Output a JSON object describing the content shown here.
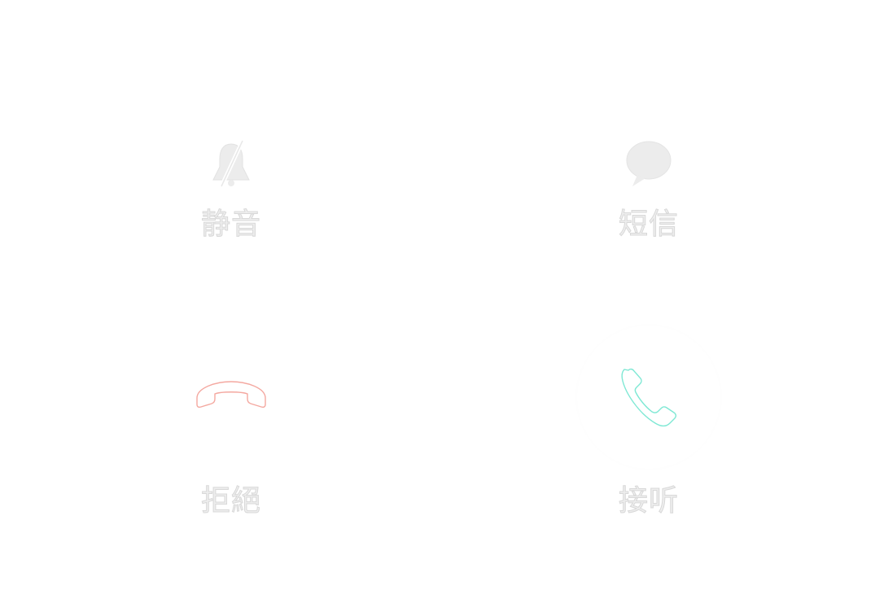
{
  "actions": {
    "mute": {
      "label": "静音",
      "icon": "bell-off-icon"
    },
    "sms": {
      "label": "短信",
      "icon": "message-bubble-icon"
    },
    "decline": {
      "label": "拒絕",
      "icon": "hang-up-phone-icon",
      "color": "#f4a8a0"
    },
    "answer": {
      "label": "接听",
      "icon": "phone-icon",
      "color": "#7ee8d4"
    }
  }
}
